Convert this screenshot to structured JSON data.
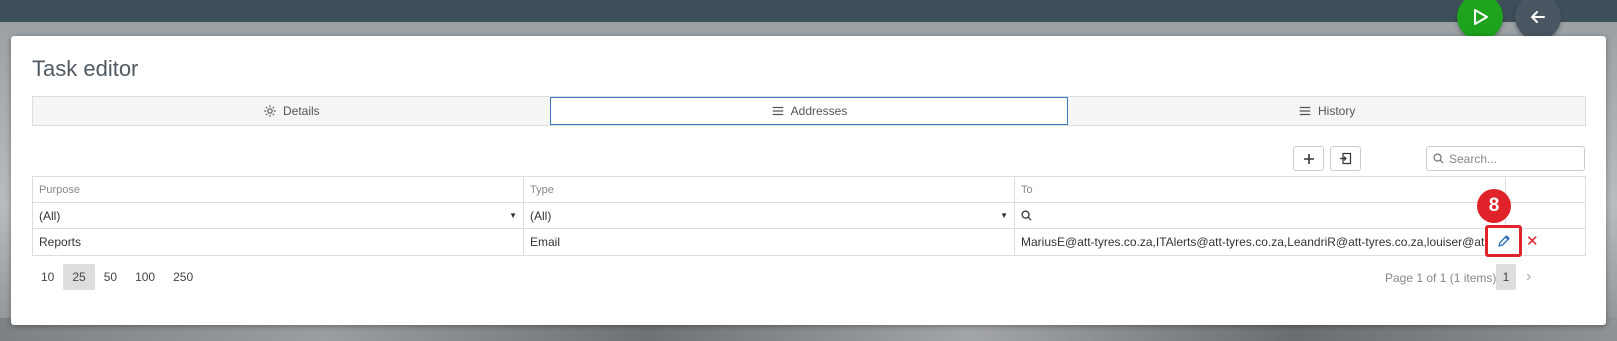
{
  "page": {
    "title": "Task editor"
  },
  "tabs": [
    {
      "label": "Details",
      "icon": "gear-icon"
    },
    {
      "label": "Addresses",
      "icon": "list-icon"
    },
    {
      "label": "History",
      "icon": "list-icon"
    }
  ],
  "toolbar": {
    "search_placeholder": "Search..."
  },
  "grid": {
    "columns": [
      "Purpose",
      "Type",
      "To"
    ],
    "filters": [
      "(All)",
      "(All)",
      ""
    ],
    "rows": [
      {
        "purpose": "Reports",
        "type": "Email",
        "to": "MariusE@att-tyres.co.za,ITAlerts@att-tyres.co.za,LeandriR@att-tyres.co.za,louiser@att-tyres.co.za"
      }
    ]
  },
  "pager": {
    "sizes": [
      "10",
      "25",
      "50",
      "100",
      "250"
    ],
    "active_size": "25",
    "info": "Page 1 of 1 (1 items)",
    "current_page": "1"
  },
  "annotation": {
    "step": "8"
  },
  "colors": {
    "accent": "#3a7bbf",
    "run": "#1da31d",
    "highlight": "#e0232a"
  }
}
